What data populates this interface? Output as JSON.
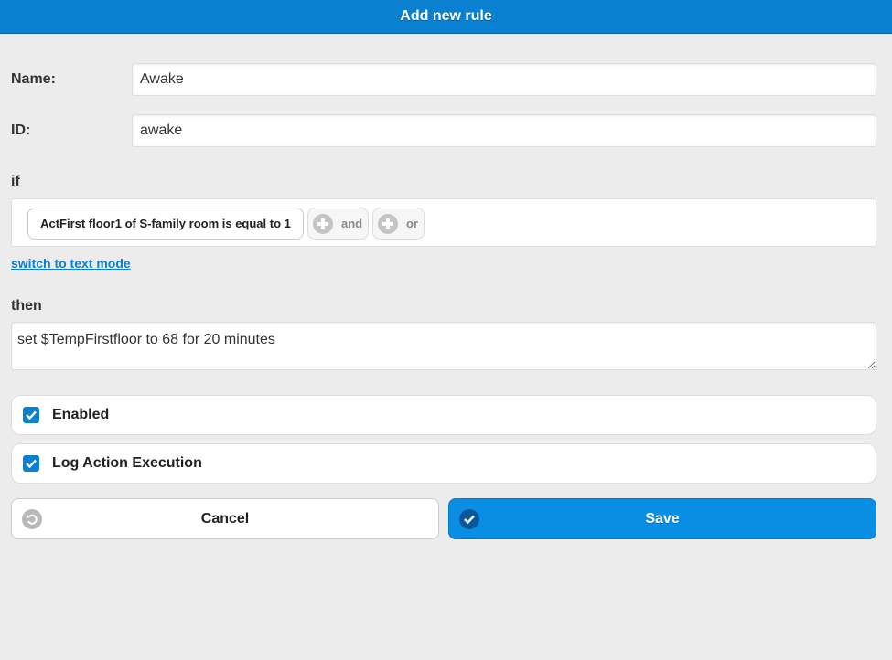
{
  "header": {
    "title": "Add new rule"
  },
  "form": {
    "name_label": "Name:",
    "name_value": "Awake",
    "id_label": "ID:",
    "id_value": "awake",
    "if_label": "if",
    "condition": "ActFirst floor1 of S-family room is equal to 1",
    "and_label": "and",
    "or_label": "or",
    "switch_mode_link": "switch to text mode",
    "then_label": "then",
    "action_text": "set $TempFirstfloor to 68 for 20 minutes",
    "enabled_label": "Enabled",
    "enabled_checked": true,
    "log_label": "Log Action Execution",
    "log_checked": true
  },
  "buttons": {
    "cancel_label": "Cancel",
    "save_label": "Save"
  },
  "colors": {
    "accent": "#0a80d0",
    "save_button": "#0a8ee4"
  },
  "icons": {
    "add_condition": "plus-circle-icon",
    "checkbox": "checkmark-icon",
    "cancel": "undo-icon",
    "save": "checkmark-circle-icon"
  }
}
